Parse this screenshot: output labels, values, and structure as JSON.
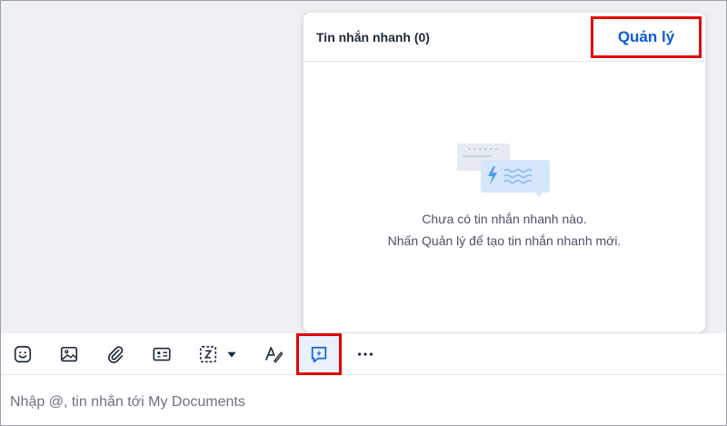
{
  "popup": {
    "title": "Tin nhắn nhanh (0)",
    "manage_label": "Quản lý",
    "empty_line1": "Chưa có tin nhắn nhanh nào.",
    "empty_line2": "Nhấn Quản lý để tạo tin nhắn nhanh mới."
  },
  "toolbar": {
    "items": [
      {
        "name": "sticker-icon"
      },
      {
        "name": "image-icon"
      },
      {
        "name": "attachment-icon"
      },
      {
        "name": "contact-card-icon"
      },
      {
        "name": "screenshot-icon"
      },
      {
        "name": "dropdown-caret-icon"
      },
      {
        "name": "text-format-icon"
      },
      {
        "name": "quick-message-icon",
        "active": true
      },
      {
        "name": "more-icon"
      }
    ]
  },
  "composer": {
    "placeholder": "Nhập @, tin nhắn tới My Documents"
  },
  "colors": {
    "accent": "#0a5bd8",
    "highlight": "#e00000",
    "chat_bg": "#eef0f3"
  }
}
